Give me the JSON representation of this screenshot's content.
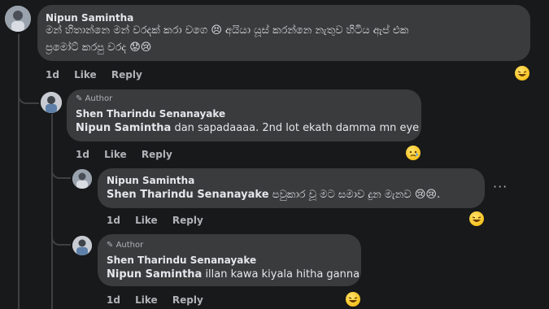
{
  "comments": [
    {
      "author": "Nipun Samintha",
      "is_author": false,
      "lines": [
        "මන් හිතාන්නෙ මන් වරදක් කරා වගෙ 😣 අයියා යූස් කරන්නෙ නැතුව හිටිය ඇප් එක",
        "ප්‍රමෝට් කරපු වරද 😟😢"
      ],
      "time": "1d",
      "like": "Like",
      "reply": "Reply",
      "reaction": "laughing-face"
    },
    {
      "author": "Shen Tharindu Senanayake",
      "is_author": true,
      "author_badge": "Author",
      "mention": "Nipun Samintha",
      "text": " dan sapadaaaa. 2nd lot ekath damma mn eye",
      "time": "1d",
      "like": "Like",
      "reply": "Reply",
      "reaction": "sad-face"
    },
    {
      "author": "Nipun Samintha",
      "is_author": false,
      "mention": "Shen Tharindu Senanayake",
      "text": " පවුකාර වූ මට සමාව දුන මැනව 😢😢.",
      "time": "1d",
      "like": "Like",
      "reply": "Reply",
      "reaction": "laughing-face",
      "more": "···"
    },
    {
      "author": "Shen Tharindu Senanayake",
      "is_author": true,
      "author_badge": "Author",
      "mention": "Nipun Samintha",
      "text": " illan kawa kiyala hitha ganna",
      "time": "1d",
      "like": "Like",
      "reply": "Reply",
      "reaction": "laughing-face"
    }
  ],
  "colors": {
    "background": "#18191a",
    "bubble": "#3a3b3c",
    "text": "#e4e6eb",
    "secondary": "#b0b3b8",
    "line": "#3e4042"
  }
}
